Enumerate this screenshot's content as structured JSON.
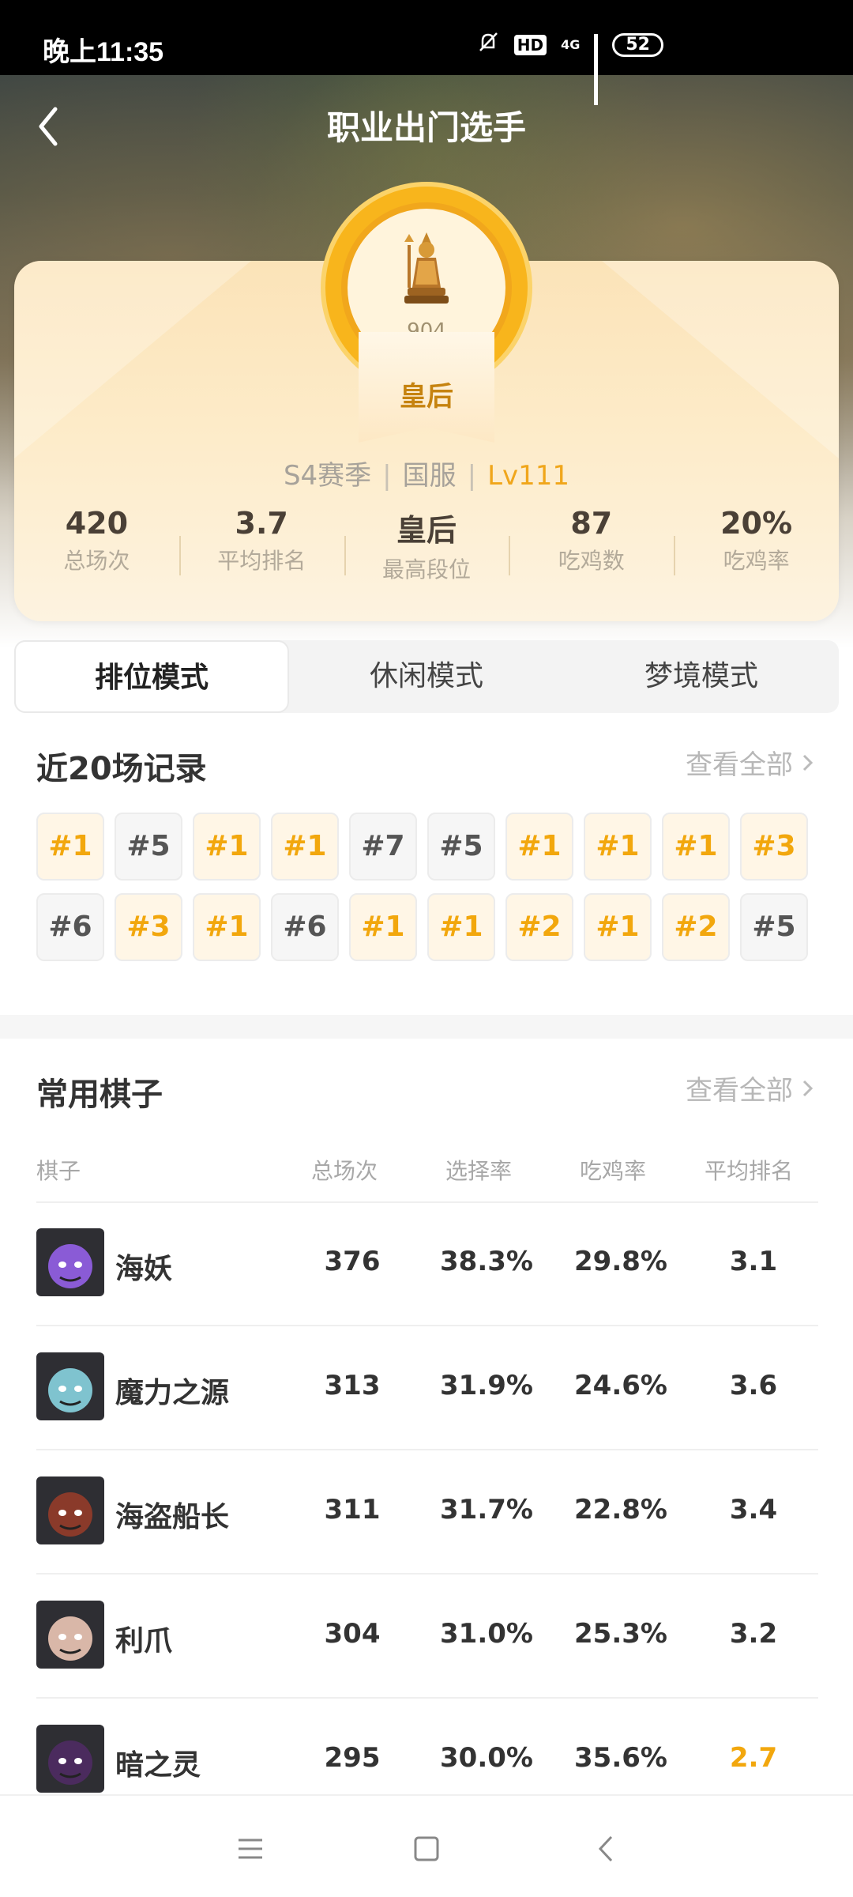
{
  "status_bar": {
    "time": "晚上11:35",
    "hd": "HD",
    "network": "4G",
    "battery": "52"
  },
  "header": {
    "title": "职业出门选手"
  },
  "profile": {
    "medal_points": "904",
    "rank_name": "皇后",
    "season": "S4赛季",
    "server": "国服",
    "level": "Lv111",
    "separator": "|",
    "stats": [
      {
        "value": "420",
        "label": "总场次"
      },
      {
        "value": "3.7",
        "label": "平均排名"
      },
      {
        "value": "皇后",
        "label": "最高段位"
      },
      {
        "value": "87",
        "label": "吃鸡数"
      },
      {
        "value": "20%",
        "label": "吃鸡率"
      }
    ]
  },
  "tabs": [
    {
      "label": "排位模式",
      "active": true
    },
    {
      "label": "休闲模式",
      "active": false
    },
    {
      "label": "梦境模式",
      "active": false
    }
  ],
  "recent": {
    "title": "近20场记录",
    "see_all": "查看全部",
    "ranks": [
      "#1",
      "#5",
      "#1",
      "#1",
      "#7",
      "#5",
      "#1",
      "#1",
      "#1",
      "#3",
      "#6",
      "#3",
      "#1",
      "#6",
      "#1",
      "#1",
      "#2",
      "#1",
      "#2",
      "#5"
    ]
  },
  "pieces": {
    "title": "常用棋子",
    "see_all": "查看全部",
    "columns": [
      "棋子",
      "总场次",
      "选择率",
      "吃鸡率",
      "平均排名"
    ],
    "rows": [
      {
        "name": "海妖",
        "games": "376",
        "pick_rate": "38.3%",
        "win_rate": "29.8%",
        "avg_rank": "3.1",
        "highlight": false,
        "avatar": "naga-siren-avatar",
        "color": "#8a5bd6"
      },
      {
        "name": "魔力之源",
        "games": "313",
        "pick_rate": "31.9%",
        "win_rate": "24.6%",
        "avg_rank": "3.6",
        "highlight": false,
        "avatar": "source-of-magic-avatar",
        "color": "#7fc3cf"
      },
      {
        "name": "海盗船长",
        "games": "311",
        "pick_rate": "31.7%",
        "win_rate": "22.8%",
        "avg_rank": "3.4",
        "highlight": false,
        "avatar": "pirate-captain-avatar",
        "color": "#8a3a2a"
      },
      {
        "name": "利爪",
        "games": "304",
        "pick_rate": "31.0%",
        "win_rate": "25.3%",
        "avg_rank": "3.2",
        "highlight": false,
        "avatar": "claw-avatar",
        "color": "#d9b7a8"
      },
      {
        "name": "暗之灵",
        "games": "295",
        "pick_rate": "30.0%",
        "win_rate": "35.6%",
        "avg_rank": "2.7",
        "highlight": true,
        "avatar": "dark-spirit-avatar",
        "color": "#4b2b5e"
      }
    ]
  }
}
